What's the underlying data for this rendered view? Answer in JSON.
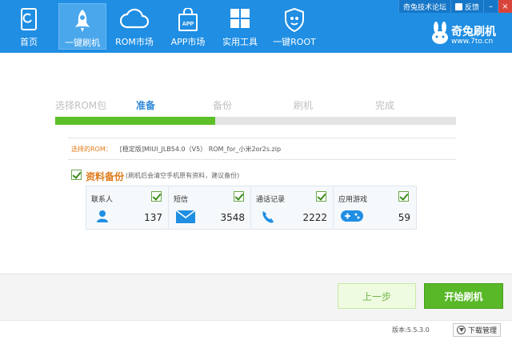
{
  "nav": {
    "items": [
      {
        "label": "首页",
        "icon": "phone-icon",
        "active": false
      },
      {
        "label": "一键刷机",
        "icon": "rocket-icon",
        "active": true
      },
      {
        "label": "ROM市场",
        "icon": "cloud-icon",
        "active": false
      },
      {
        "label": "APP市场",
        "icon": "app-bag-icon",
        "active": false
      },
      {
        "label": "实用工具",
        "icon": "grid-icon",
        "active": false
      },
      {
        "label": "一键ROOT",
        "icon": "shield-icon",
        "active": false
      }
    ]
  },
  "top_links": {
    "forum": "奇兔技术论坛",
    "feedback": "反馈",
    "minimize": "–",
    "close": "×"
  },
  "brand": {
    "name": "奇兔刷机",
    "url": "www.7to.cn"
  },
  "steps": {
    "items": [
      "选择ROM包",
      "准备",
      "备份",
      "刷机",
      "完成"
    ],
    "active_index": 1,
    "progress": 0.4
  },
  "rom": {
    "label": "选择的ROM：",
    "value": "[稳定版]MIUI_JLB54.0（V5） ROM_for_小米2or2s.zip"
  },
  "backup": {
    "title": "资料备份",
    "hint": "(刷机后会清空手机原有资料，建议备份)",
    "checked": true,
    "cards": [
      {
        "name": "联系人",
        "count": "137",
        "icon": "contact-icon",
        "checked": true
      },
      {
        "name": "短信",
        "count": "3548",
        "icon": "envelope-icon",
        "checked": true
      },
      {
        "name": "通话记录",
        "count": "2222",
        "icon": "phone-handset-icon",
        "checked": true
      },
      {
        "name": "应用游戏",
        "count": "59",
        "icon": "gamepad-icon",
        "checked": true
      }
    ]
  },
  "buttons": {
    "prev": "上一步",
    "start": "开始刷机"
  },
  "status": {
    "version": "版本:5.5.3.0",
    "download": "下载管理"
  },
  "colors": {
    "header": "#1f8ee3",
    "progress": "#5cbf27",
    "accent_orange": "#e07b1a",
    "start_button": "#59b828"
  }
}
